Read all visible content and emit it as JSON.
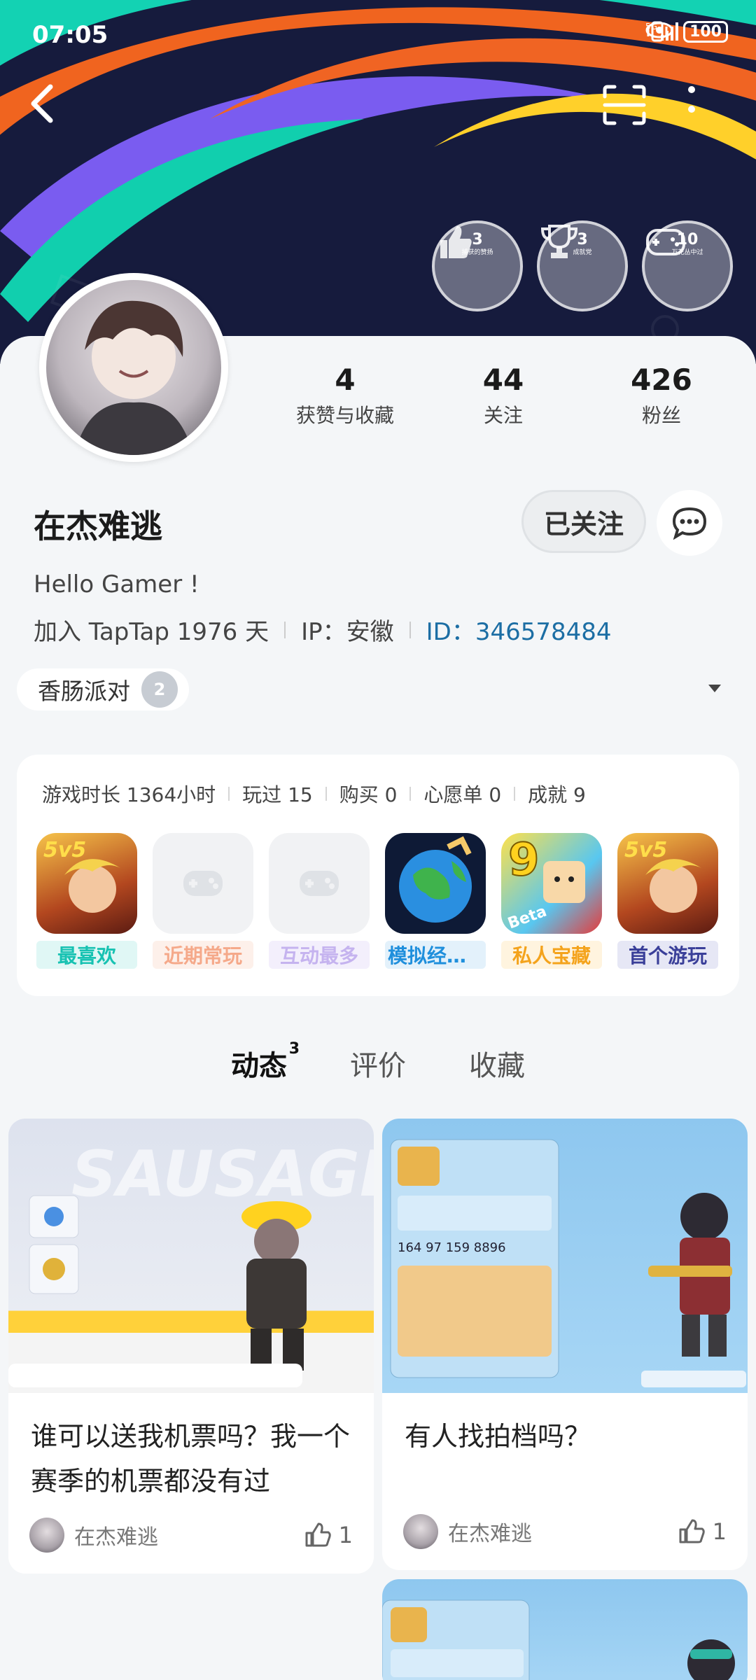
{
  "status_bar": {
    "time": "07:05",
    "battery": "100"
  },
  "badges": [
    {
      "num": "3",
      "label": "捕获的赞扬",
      "icon": "thumbs-up-icon"
    },
    {
      "num": "3",
      "label": "成就党",
      "icon": "trophy-icon"
    },
    {
      "num": "10",
      "label": "万花丛中过",
      "icon": "gamepad-icon"
    }
  ],
  "stats": [
    {
      "value": "4",
      "label": "获赞与收藏"
    },
    {
      "value": "44",
      "label": "关注"
    },
    {
      "value": "426",
      "label": "粉丝"
    }
  ],
  "profile": {
    "username": "在杰难逃",
    "follow_label": "已关注",
    "bio": "Hello Gamer !",
    "joined": "加入 TapTap 1976 天",
    "ip": "IP：安徽",
    "id": "ID：346578484",
    "tag": "香肠派对",
    "tag_icon_text": "2"
  },
  "games_card": {
    "stats": [
      "游戏时长 1364小时",
      "玩过 15",
      "购买 0",
      "心愿单 0",
      "成就 9"
    ],
    "games": [
      {
        "label": "最喜欢",
        "color": "#17c2b2",
        "bg": "#e0f7f5",
        "icon": "honor-of-kings-icon"
      },
      {
        "label": "近期常玩",
        "color": "#f5a98a",
        "bg": "#fdf0ea",
        "icon": "gamepad-placeholder-icon"
      },
      {
        "label": "互动最多",
        "color": "#c5b3ef",
        "bg": "#f3effc",
        "icon": "gamepad-placeholder-icon"
      },
      {
        "label": "模拟经营...",
        "color": "#1f8fdc",
        "bg": "#e3f1fb",
        "icon": "earth-game-icon"
      },
      {
        "label": "私人宝藏",
        "color": "#f4a31c",
        "bg": "#fff4df",
        "icon": "beta-game-icon"
      },
      {
        "label": "首个游玩",
        "color": "#3a3f99",
        "bg": "#e6e7f5",
        "icon": "honor-of-kings-icon"
      }
    ]
  },
  "tabs": [
    {
      "label": "动态",
      "count": "3"
    },
    {
      "label": "评价"
    },
    {
      "label": "收藏"
    }
  ],
  "posts": [
    {
      "title": "谁可以送我机票吗？我一个赛季的机票都没有过",
      "author": "在杰难逃",
      "likes": "1"
    },
    {
      "title": "有人找拍档吗？",
      "author": "在杰难逃",
      "likes": "1"
    }
  ]
}
